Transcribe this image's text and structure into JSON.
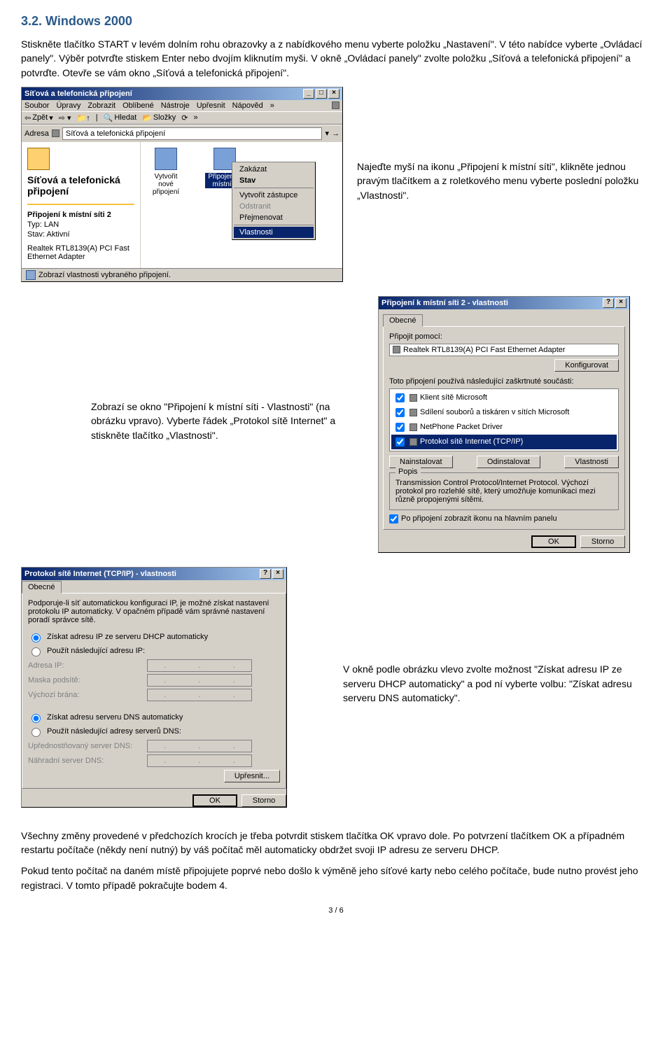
{
  "heading": "3.2. Windows 2000",
  "intro": "Stiskněte tlačítko START v levém dolním rohu obrazovky a z nabídkového menu vyberte položku „Nastavení\". V této nabídce vyberte „Ovládací panely\". Výběr potvrďte stiskem Enter nebo dvojím kliknutím myši. V okně „Ovládací panely\" zvolte položku „Síťová a telefonická připojení\" a potvrďte. Otevře se vám okno „Síťová a telefonická připojení\".",
  "explorer": {
    "title": "Síťová a telefonická připojení",
    "menus": [
      "Soubor",
      "Úpravy",
      "Zobrazit",
      "Oblíbené",
      "Nástroje",
      "Upřesnit",
      "Nápověd"
    ],
    "toolbar": {
      "back": "Zpět",
      "forward": "→",
      "up": "↑",
      "search": "Hledat",
      "folders": "Složky",
      "history": "⟳"
    },
    "address_label": "Adresa",
    "address_value": "Síťová a telefonická připojení",
    "go": "→",
    "left": {
      "title": "Síťová a telefonická připojení",
      "sub1_label": "Připojení k místní síti 2",
      "type_label": "Typ: LAN",
      "state_label": "Stav: Aktivní",
      "adapter": "Realtek RTL8139(A) PCI Fast Ethernet Adapter"
    },
    "icons": {
      "new": "Vytvořit nové připojení",
      "conn": "Připojení k místní s"
    },
    "context": {
      "disable": "Zakázat",
      "status": "Stav",
      "shortcut": "Vytvořit zástupce",
      "delete": "Odstranit",
      "rename": "Přejmenovat",
      "props": "Vlastnosti"
    },
    "statusbar": "Zobrazí vlastnosti vybraného připojení."
  },
  "note1": "Najeďte myší na ikonu „Připojení k místní síti\", klikněte jednou pravým tlačítkem a z roletkového menu vyberte poslední položku „Vlastnosti\".",
  "note2": "Zobrazí se okno \"Připojení k místní síti - Vlastnosti\" (na obrázku vpravo). Vyberte řádek „Protokol sítě Internet\" a stiskněte tlačítko „Vlastnosti\".",
  "note3": "V okně podle obrázku vlevo zvolte možnost \"Získat adresu IP ze serveru DHCP automaticky\" a pod ní vyberte volbu: \"Získat adresu serveru DNS automaticky\".",
  "conn_props": {
    "title": "Připojení k místní síti 2 - vlastnosti",
    "tab": "Obecné",
    "connect_using": "Připojit pomocí:",
    "adapter": "Realtek RTL8139(A) PCI Fast Ethernet Adapter",
    "configure": "Konfigurovat",
    "components_label": "Toto připojení používá následující zaškrtnuté součásti:",
    "items": [
      "Klient sítě Microsoft",
      "Sdílení souborů a tiskáren v sítích Microsoft",
      "NetPhone Packet Driver",
      "Protokol sítě Internet (TCP/IP)"
    ],
    "install": "Nainstalovat",
    "uninstall": "Odinstalovat",
    "properties": "Vlastnosti",
    "desc_label": "Popis",
    "desc_text": "Transmission Control Protocol/Internet Protocol. Výchozí protokol pro rozlehlé sítě, který umožňuje komunikaci mezi různě propojenými sítěmi.",
    "show_icon": "Po připojení zobrazit ikonu na hlavním panelu",
    "ok": "OK",
    "cancel": "Storno"
  },
  "tcpip": {
    "title": "Protokol sítě Internet (TCP/IP) - vlastnosti",
    "tab": "Obecné",
    "intro": "Podporuje-li síť automatickou konfiguraci IP, je možné získat nastavení protokolu IP automaticky. V opačném případě vám správné nastavení poradí správce sítě.",
    "r1": "Získat adresu IP ze serveru DHCP automaticky",
    "r2": "Použít následující adresu IP:",
    "ip_label": "Adresa IP:",
    "mask_label": "Maska podsítě:",
    "gw_label": "Výchozí brána:",
    "r3": "Získat adresu serveru DNS automaticky",
    "r4": "Použít následující adresy serverů DNS:",
    "dns1": "Upřednostňovaný server DNS:",
    "dns2": "Náhradní server DNS:",
    "advbtn": "Upřesnit...",
    "ok": "OK",
    "cancel": "Storno"
  },
  "outro1": "Všechny změny provedené v předchozích krocích je třeba potvrdit stiskem tlačítka OK vpravo dole. Po potvrzení tlačítkem OK a případném restartu počítače (někdy není nutný) by váš počítač měl automaticky obdržet svoji IP adresu ze serveru DHCP.",
  "outro2": "Pokud tento počítač na daném místě připojujete poprvé nebo došlo k výměně jeho síťové karty nebo celého počítače, bude nutno provést jeho registraci. V tomto případě pokračujte bodem 4.",
  "pagefoot": "3 / 6"
}
